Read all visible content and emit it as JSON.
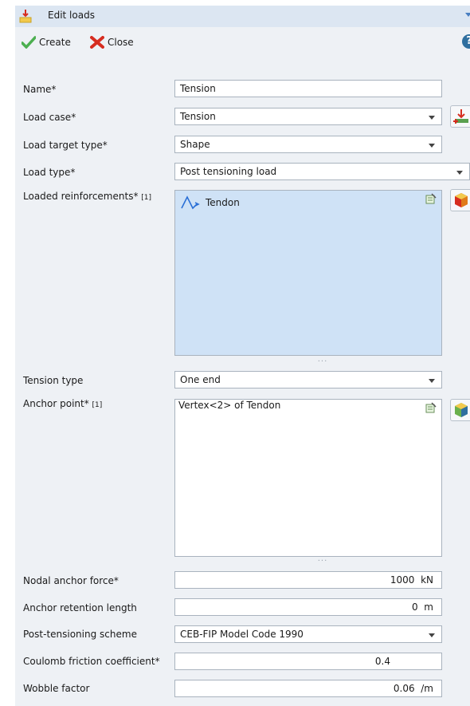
{
  "window": {
    "title": "Edit loads"
  },
  "toolbar": {
    "create_label": "Create",
    "close_label": "Close",
    "help_label": "?"
  },
  "form": {
    "name": {
      "label": "Name*",
      "value": "Tension"
    },
    "load_case": {
      "label": "Load case*",
      "value": "Tension"
    },
    "load_target_type": {
      "label": "Load target type*",
      "value": "Shape"
    },
    "load_type": {
      "label": "Load type*",
      "value": "Post tensioning load"
    },
    "loaded_reinforcements": {
      "label": "Loaded reinforcements*",
      "count": "[1]",
      "items": [
        "Tendon"
      ]
    },
    "tension_type": {
      "label": "Tension type",
      "value": "One end"
    },
    "anchor_point": {
      "label": "Anchor point*",
      "count": "[1]",
      "items": [
        "Vertex<2> of Tendon"
      ]
    },
    "nodal_anchor_force": {
      "label": "Nodal anchor force*",
      "value": "1000",
      "unit": "kN"
    },
    "anchor_retention_length": {
      "label": "Anchor retention length",
      "value": "0",
      "unit": "m"
    },
    "post_tensioning_scheme": {
      "label": "Post-tensioning scheme",
      "value": "CEB-FIP Model Code 1990"
    },
    "coulomb_friction": {
      "label": "Coulomb friction coefficient*",
      "value": "0.4"
    },
    "wobble_factor": {
      "label": "Wobble factor",
      "value": "0.06",
      "unit": "/m"
    }
  },
  "grip_text": "···"
}
